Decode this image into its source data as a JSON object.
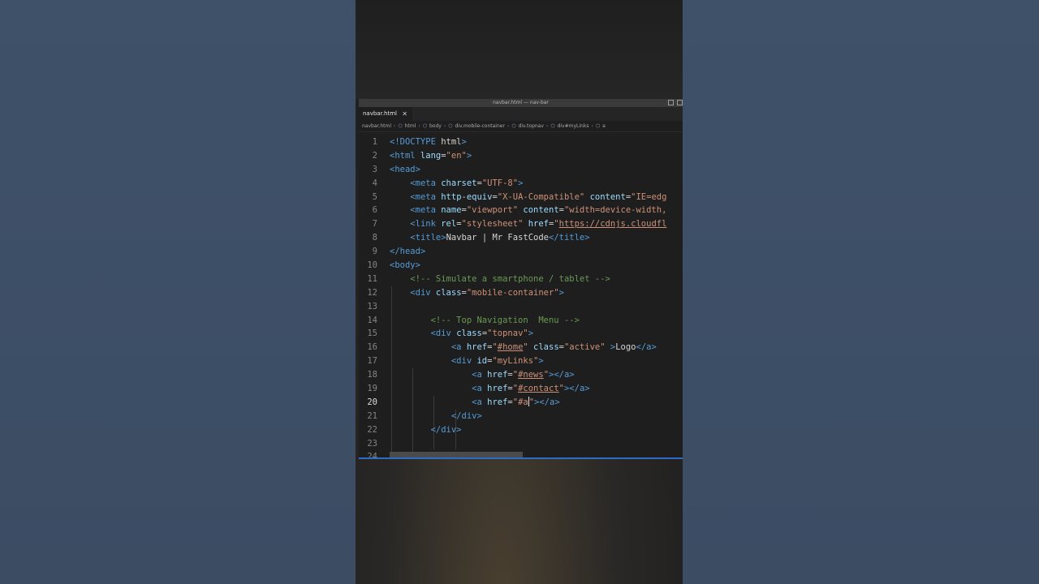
{
  "window": {
    "title": "navbar.html — nav-bar"
  },
  "tab": {
    "label": "navbar.html",
    "close_glyph": "✕"
  },
  "breadcrumb": [
    "navbar.html",
    "html",
    "body",
    "div.mobile-container",
    "div.topnav",
    "div#myLinks",
    "a"
  ],
  "icons": {
    "breadcrumb_element": "cube-icon",
    "tab_close": "close-icon"
  },
  "colors": {
    "tag": "#569cd6",
    "attribute": "#9cdcfe",
    "string": "#ce9178",
    "comment": "#6a9955",
    "text": "#d4d4d4"
  },
  "cursor_line": 20,
  "code_lines": [
    {
      "n": "1",
      "segs": [
        [
          "tag",
          "<!DOCTYPE"
        ],
        [
          "plain",
          " html"
        ],
        [
          "tag",
          ">"
        ]
      ]
    },
    {
      "n": "2",
      "segs": [
        [
          "tag",
          "<html"
        ],
        [
          "attr",
          " lang"
        ],
        [
          "plain",
          "="
        ],
        [
          "str",
          "\"en\""
        ],
        [
          "tag",
          ">"
        ]
      ]
    },
    {
      "n": "3",
      "segs": [
        [
          "tag",
          "<head>"
        ]
      ]
    },
    {
      "n": "4",
      "segs": [
        [
          "plain",
          "    "
        ],
        [
          "tag",
          "<meta"
        ],
        [
          "attr",
          " charset"
        ],
        [
          "plain",
          "="
        ],
        [
          "str",
          "\"UTF-8\""
        ],
        [
          "tag",
          ">"
        ]
      ]
    },
    {
      "n": "5",
      "segs": [
        [
          "plain",
          "    "
        ],
        [
          "tag",
          "<meta"
        ],
        [
          "attr",
          " http-equiv"
        ],
        [
          "plain",
          "="
        ],
        [
          "str",
          "\"X-UA-Compatible\""
        ],
        [
          "attr",
          " content"
        ],
        [
          "plain",
          "="
        ],
        [
          "str",
          "\"IE=edg"
        ]
      ]
    },
    {
      "n": "6",
      "segs": [
        [
          "plain",
          "    "
        ],
        [
          "tag",
          "<meta"
        ],
        [
          "attr",
          " name"
        ],
        [
          "plain",
          "="
        ],
        [
          "str",
          "\"viewport\""
        ],
        [
          "attr",
          " content"
        ],
        [
          "plain",
          "="
        ],
        [
          "str",
          "\"width=device-width,"
        ]
      ]
    },
    {
      "n": "7",
      "segs": [
        [
          "plain",
          "    "
        ],
        [
          "tag",
          "<link"
        ],
        [
          "attr",
          " rel"
        ],
        [
          "plain",
          "="
        ],
        [
          "str",
          "\"stylesheet\""
        ],
        [
          "attr",
          " href"
        ],
        [
          "plain",
          "="
        ],
        [
          "str",
          "\""
        ],
        [
          "strurl",
          "https://cdnjs.cloudfl"
        ]
      ]
    },
    {
      "n": "8",
      "segs": [
        [
          "plain",
          "    "
        ],
        [
          "tag",
          "<title>"
        ],
        [
          "plain",
          "Navbar | Mr FastCode"
        ],
        [
          "tag",
          "</title>"
        ]
      ]
    },
    {
      "n": "9",
      "segs": [
        [
          "tag",
          "</head>"
        ]
      ]
    },
    {
      "n": "10",
      "segs": [
        [
          "tag",
          "<body>"
        ]
      ]
    },
    {
      "n": "11",
      "segs": [
        [
          "plain",
          "    "
        ],
        [
          "cm",
          "<!-- Simulate a smartphone / tablet -->"
        ]
      ]
    },
    {
      "n": "12",
      "segs": [
        [
          "plain",
          "    "
        ],
        [
          "tag",
          "<div"
        ],
        [
          "attr",
          " class"
        ],
        [
          "plain",
          "="
        ],
        [
          "str",
          "\"mobile-container\""
        ],
        [
          "tag",
          ">"
        ]
      ]
    },
    {
      "n": "13",
      "segs": []
    },
    {
      "n": "14",
      "segs": [
        [
          "plain",
          "        "
        ],
        [
          "cm",
          "<!-- Top Navigation  Menu -->"
        ]
      ]
    },
    {
      "n": "15",
      "segs": [
        [
          "plain",
          "        "
        ],
        [
          "tag",
          "<div"
        ],
        [
          "attr",
          " class"
        ],
        [
          "plain",
          "="
        ],
        [
          "str",
          "\"topnav\""
        ],
        [
          "tag",
          ">"
        ]
      ]
    },
    {
      "n": "16",
      "segs": [
        [
          "plain",
          "            "
        ],
        [
          "tag",
          "<a"
        ],
        [
          "attr",
          " href"
        ],
        [
          "plain",
          "="
        ],
        [
          "str",
          "\""
        ],
        [
          "strurl",
          "#home"
        ],
        [
          "str",
          "\""
        ],
        [
          "attr",
          " class"
        ],
        [
          "plain",
          "="
        ],
        [
          "str",
          "\"active\""
        ],
        [
          "plain",
          " "
        ],
        [
          "tag",
          ">"
        ],
        [
          "plain",
          "Logo"
        ],
        [
          "tag",
          "</a>"
        ]
      ]
    },
    {
      "n": "17",
      "segs": [
        [
          "plain",
          "            "
        ],
        [
          "tag",
          "<div"
        ],
        [
          "attr",
          " id"
        ],
        [
          "plain",
          "="
        ],
        [
          "str",
          "\"myLinks\""
        ],
        [
          "tag",
          ">"
        ]
      ]
    },
    {
      "n": "18",
      "segs": [
        [
          "plain",
          "                "
        ],
        [
          "tag",
          "<a"
        ],
        [
          "attr",
          " href"
        ],
        [
          "plain",
          "="
        ],
        [
          "str",
          "\""
        ],
        [
          "strurl",
          "#news"
        ],
        [
          "str",
          "\""
        ],
        [
          "tag",
          "></a>"
        ]
      ]
    },
    {
      "n": "19",
      "segs": [
        [
          "plain",
          "                "
        ],
        [
          "tag",
          "<a"
        ],
        [
          "attr",
          " href"
        ],
        [
          "plain",
          "="
        ],
        [
          "str",
          "\""
        ],
        [
          "strurl",
          "#contact"
        ],
        [
          "str",
          "\""
        ],
        [
          "tag",
          "></a>"
        ]
      ]
    },
    {
      "n": "20",
      "segs": [
        [
          "plain",
          "                "
        ],
        [
          "tag",
          "<a"
        ],
        [
          "attr",
          " href"
        ],
        [
          "plain",
          "="
        ],
        [
          "str",
          "\"#a"
        ],
        [
          "cursor",
          ""
        ],
        [
          "str",
          "\""
        ],
        [
          "tag",
          "></a>"
        ]
      ]
    },
    {
      "n": "21",
      "segs": [
        [
          "plain",
          "            "
        ],
        [
          "tag",
          "</div>"
        ]
      ]
    },
    {
      "n": "22",
      "segs": [
        [
          "plain",
          "        "
        ],
        [
          "tag",
          "</div>"
        ]
      ]
    },
    {
      "n": "23",
      "segs": []
    },
    {
      "n": "24",
      "segs": [
        [
          "plain",
          "    "
        ],
        [
          "tag",
          "</div>"
        ]
      ]
    }
  ]
}
